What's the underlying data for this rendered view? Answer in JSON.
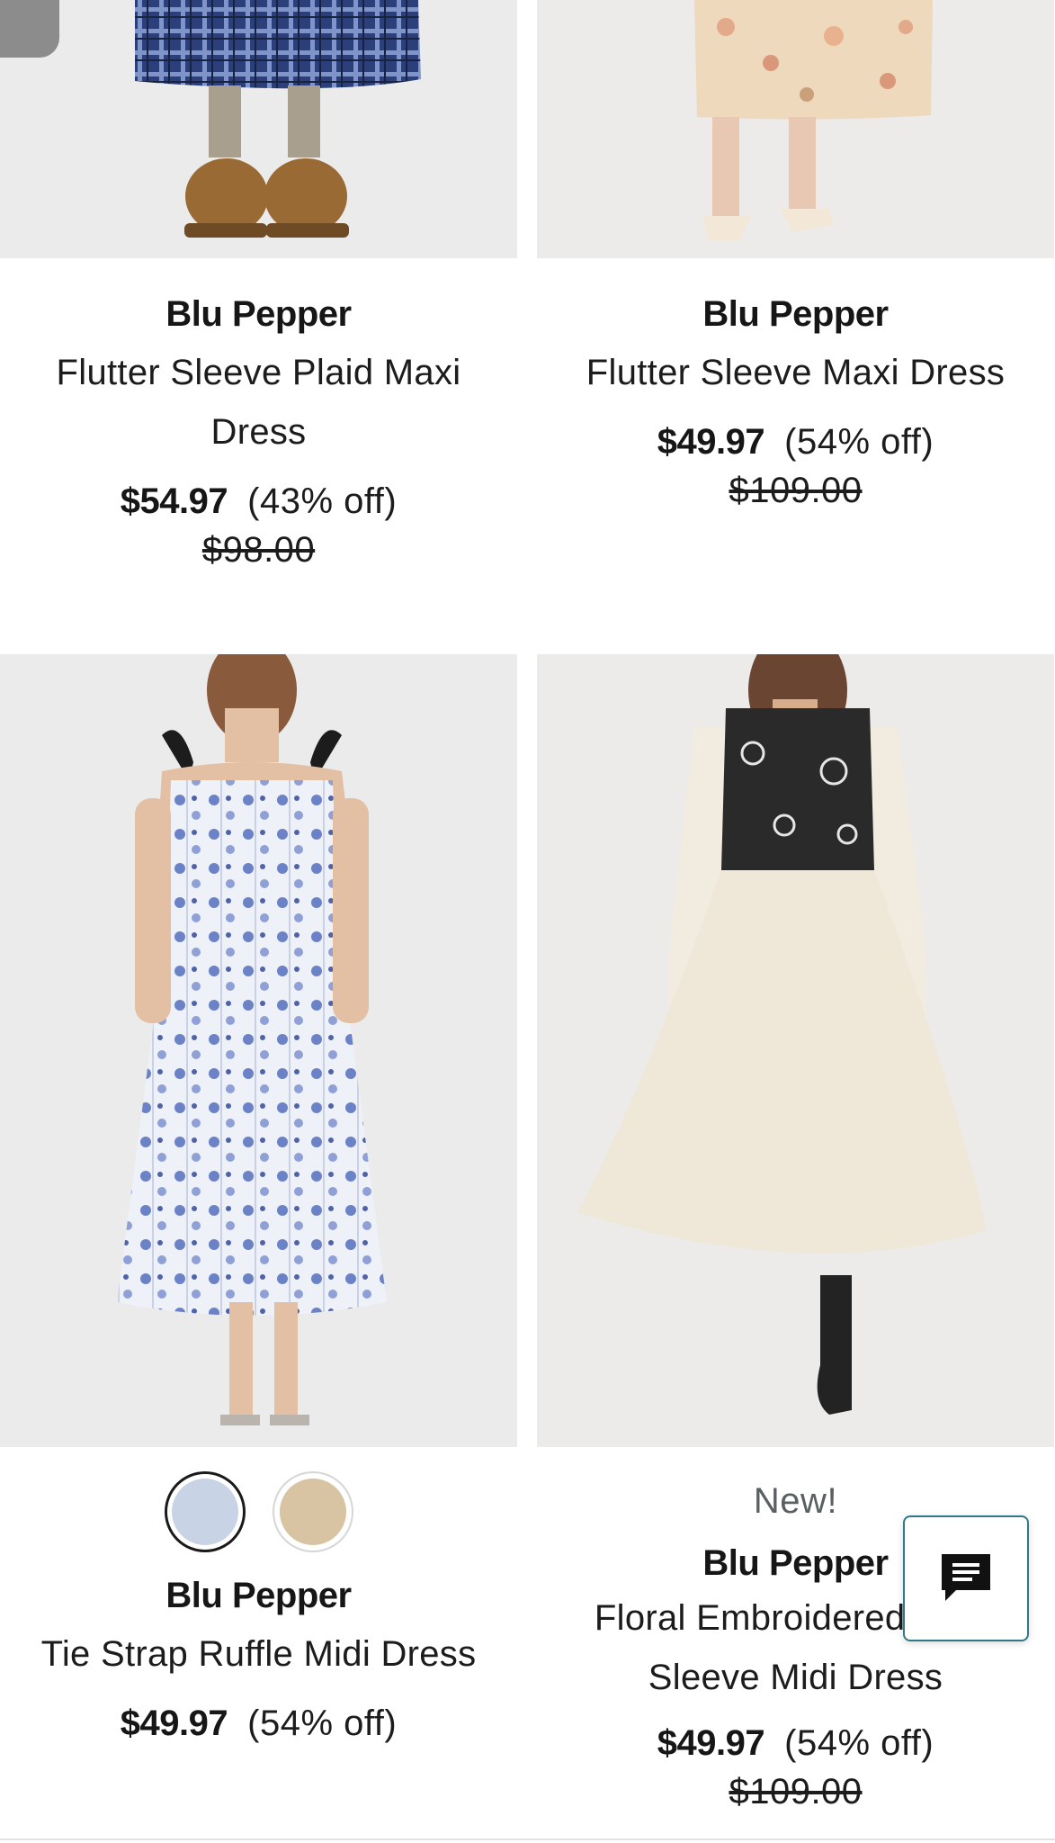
{
  "colors": {
    "text": "#1c1c1c",
    "muted": "#5a6062",
    "chat_border": "#2f7a86",
    "image_bg": "#eeedec"
  },
  "products": [
    {
      "brand": "Blu Pepper",
      "name": "Flutter Sleeve Plaid Maxi Dress",
      "price": "$54.97",
      "discount": "(43% off)",
      "original_price": "$98.00",
      "image_icon": "plaid-dress-photo"
    },
    {
      "brand": "Blu Pepper",
      "name": "Flutter Sleeve Maxi Dress",
      "price": "$49.97",
      "discount": "(54% off)",
      "original_price": "$109.00",
      "image_icon": "floral-dress-photo"
    },
    {
      "brand": "Blu Pepper",
      "name": "Tie Strap Ruffle Midi Dress",
      "price": "$49.97",
      "discount": "(54% off)",
      "image_icon": "blue-floral-midi-dress-photo",
      "swatches": [
        {
          "label": "blue floral",
          "color": "#c9d3e6",
          "selected": true
        },
        {
          "label": "tan floral",
          "color": "#d8c3a2",
          "selected": false
        }
      ]
    },
    {
      "badge": "New!",
      "brand": "Blu Pepper",
      "name": "Floral Embroidered Long Sleeve Midi Dress",
      "price": "$49.97",
      "discount": "(54% off)",
      "original_price": "$109.00",
      "image_icon": "embroidered-midi-dress-photo"
    }
  ],
  "chat": {
    "icon": "chat-bubble-icon"
  }
}
